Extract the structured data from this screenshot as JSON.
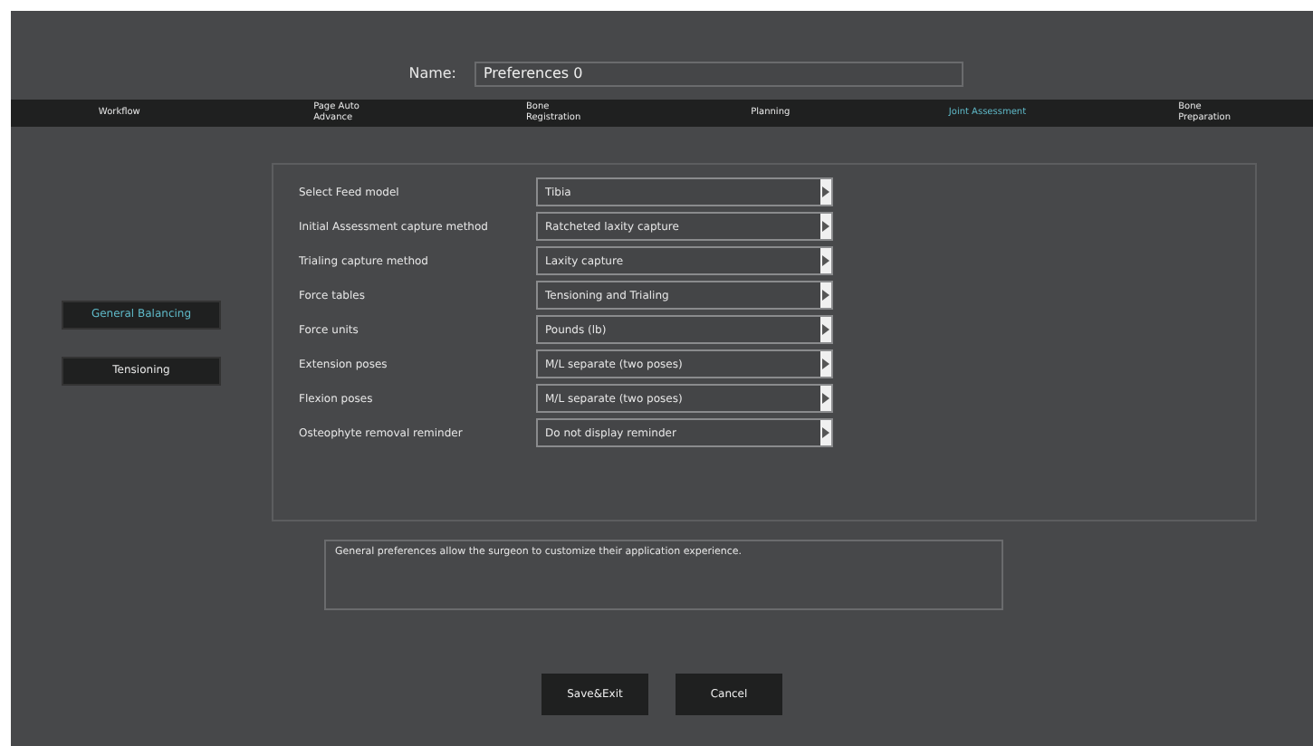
{
  "name_field": {
    "label": "Name:",
    "value": "Preferences 0"
  },
  "tabs": [
    {
      "label": "Workflow",
      "selected": false
    },
    {
      "label": "Page Auto\nAdvance",
      "selected": false
    },
    {
      "label": "Bone\nRegistration",
      "selected": false
    },
    {
      "label": "Planning",
      "selected": false
    },
    {
      "label": "Joint Assessment",
      "selected": true
    },
    {
      "label": "Bone\nPreparation",
      "selected": false
    }
  ],
  "side_nav": [
    {
      "label": "General Balancing",
      "selected": true
    },
    {
      "label": "Tensioning",
      "selected": false
    }
  ],
  "settings": [
    {
      "label": "Select Feed model",
      "value": "Tibia"
    },
    {
      "label": "Initial Assessment capture method",
      "value": "Ratcheted laxity capture"
    },
    {
      "label": "Trialing capture method",
      "value": "Laxity capture"
    },
    {
      "label": "Force tables",
      "value": "Tensioning and Trialing"
    },
    {
      "label": "Force units",
      "value": "Pounds (lb)"
    },
    {
      "label": "Extension poses",
      "value": "M/L separate (two poses)"
    },
    {
      "label": "Flexion poses",
      "value": "M/L separate (two poses)"
    },
    {
      "label": "Osteophyte removal reminder",
      "value": "Do not display reminder"
    }
  ],
  "description": "General preferences allow the surgeon to customize their application experience.",
  "buttons": [
    "Save&Exit",
    "Cancel"
  ]
}
